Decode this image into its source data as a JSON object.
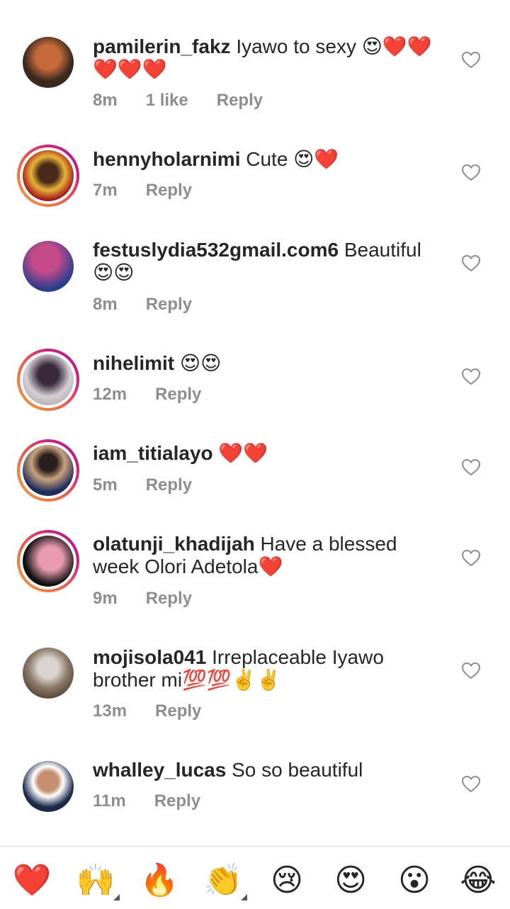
{
  "comments": [
    {
      "username": "pamilerin_fakz",
      "text": "Iyawo to sexy 😍❤️❤️❤️❤️❤️",
      "time": "8m",
      "likes": "1 like",
      "reply_label": "Reply",
      "avatar_colors": [
        "#3a2a1e",
        "#b5542a"
      ]
    },
    {
      "username": "hennyholarnimi",
      "text": "Cute 😍❤️",
      "time": "7m",
      "reply_label": "Reply",
      "avatar_colors": [
        "#a51b1b",
        "#e7b437"
      ]
    },
    {
      "username": "festuslydia532gmail.com6",
      "text": "Beautiful 😍😍",
      "time": "8m",
      "reply_label": "Reply",
      "avatar_colors": [
        "#2a3e8e",
        "#c64b8a"
      ]
    },
    {
      "username": "nihelimit",
      "text": "😍😍",
      "time": "12m",
      "reply_label": "Reply",
      "avatar_colors": [
        "#d4d0d4",
        "#3a2a3a"
      ]
    },
    {
      "username": "iam_titialayo",
      "text": "❤️❤️",
      "time": "5m",
      "reply_label": "Reply",
      "avatar_colors": [
        "#1f2d5c",
        "#c9a27c"
      ]
    },
    {
      "username": "olatunji_khadijah",
      "text": "Have a blessed week Olori Adetola❤️",
      "time": "9m",
      "reply_label": "Reply",
      "avatar_colors": [
        "#111111",
        "#e89ab0"
      ]
    },
    {
      "username": "mojisola041",
      "text": "Irreplaceable Iyawo brother mi💯💯✌️✌️",
      "time": "13m",
      "reply_label": "Reply",
      "avatar_colors": [
        "#5e4a3a",
        "#d9d4cf"
      ]
    },
    {
      "username": "whalley_lucas",
      "text": "So so beautiful",
      "time": "11m",
      "reply_label": "Reply",
      "avatar_colors": [
        "#1c2a4a",
        "#c58f6f"
      ]
    }
  ],
  "emoji_bar": [
    {
      "emoji": "❤️",
      "name": "red-heart"
    },
    {
      "emoji": "🙌",
      "name": "raising-hands"
    },
    {
      "emoji": "🔥",
      "name": "fire"
    },
    {
      "emoji": "👏",
      "name": "clapping-hands"
    },
    {
      "emoji": "😢",
      "name": "crying-face"
    },
    {
      "emoji": "😍",
      "name": "heart-eyes"
    },
    {
      "emoji": "😮",
      "name": "surprised-face"
    },
    {
      "emoji": "😂",
      "name": "tears-of-joy"
    }
  ],
  "colors": {
    "text": "#262626",
    "meta": "#8e8e8e",
    "divider": "#dbdbdb",
    "story_ring_start": "#f9a133",
    "story_ring_end": "#a012a3"
  },
  "icons": {
    "like": "heart-outline-icon"
  }
}
